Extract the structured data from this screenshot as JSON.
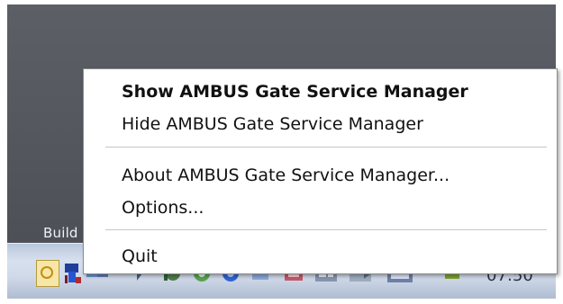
{
  "desktop": {
    "label": "Build"
  },
  "taskbar": {
    "time": "07:50",
    "icons": [
      "clock-tray-icon",
      "network-tray-icon",
      "drive-tray-icon",
      "chevron-tray-icon",
      "status-tray-icon",
      "app-tray-icon",
      "app-tray-icon",
      "folder-tray-icon",
      "screen-tray-icon",
      "tray-icon",
      "tray-icon"
    ]
  },
  "context_menu": {
    "items": [
      {
        "label": "Show AMBUS Gate Service Manager",
        "bold": true
      },
      {
        "label": "Hide AMBUS Gate Service Manager",
        "bold": false
      },
      {
        "label": "About AMBUS Gate Service Manager...",
        "bold": false
      },
      {
        "label": "Options...",
        "bold": false
      },
      {
        "label": "Quit",
        "bold": false
      }
    ]
  }
}
